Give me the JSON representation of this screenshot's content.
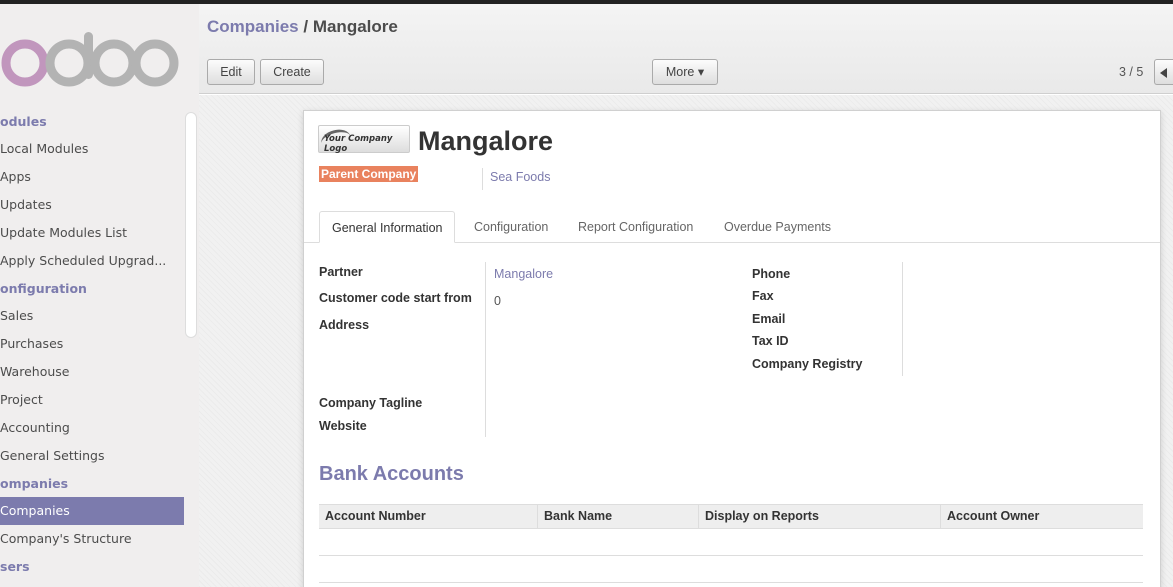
{
  "app": {
    "logo_text": "odoo"
  },
  "sidebar": {
    "sections": [
      {
        "header": "odules",
        "items": [
          "Local Modules",
          "Apps",
          "Updates",
          "Update Modules List",
          "Apply Scheduled Upgrad..."
        ]
      },
      {
        "header": "onfiguration",
        "items": [
          "Sales",
          "Purchases",
          "Warehouse",
          "Project",
          "Accounting",
          "General Settings"
        ]
      },
      {
        "header": "ompanies",
        "items": [
          "Companies",
          "Company's Structure"
        ]
      },
      {
        "header": "sers",
        "items": []
      }
    ],
    "active_item": "Companies"
  },
  "header": {
    "breadcrumb_parent": "Companies",
    "breadcrumb_sep": " / ",
    "breadcrumb_current": "Mangalore",
    "edit_label": "Edit",
    "create_label": "Create",
    "more_label": "More ▾",
    "pager": "3 / 5"
  },
  "record": {
    "logo_text": "Your Company Logo",
    "name": "Mangalore",
    "parent_label": "Parent Company",
    "parent_value": "Sea Foods"
  },
  "tabs": [
    "General Information",
    "Configuration",
    "Report Configuration",
    "Overdue Payments"
  ],
  "form": {
    "partner_label": "Partner",
    "partner_value": "Mangalore",
    "customer_code_label": "Customer code start from",
    "customer_code_value": "0",
    "address_label": "Address",
    "tagline_label": "Company Tagline",
    "website_label": "Website",
    "phone_label": "Phone",
    "fax_label": "Fax",
    "email_label": "Email",
    "taxid_label": "Tax ID",
    "registry_label": "Company Registry"
  },
  "bank": {
    "title": "Bank Accounts",
    "columns": [
      "Account Number",
      "Bank Name",
      "Display on Reports",
      "Account Owner"
    ]
  },
  "colors": {
    "accent": "#7c7bad",
    "badge": "#e9825e"
  }
}
